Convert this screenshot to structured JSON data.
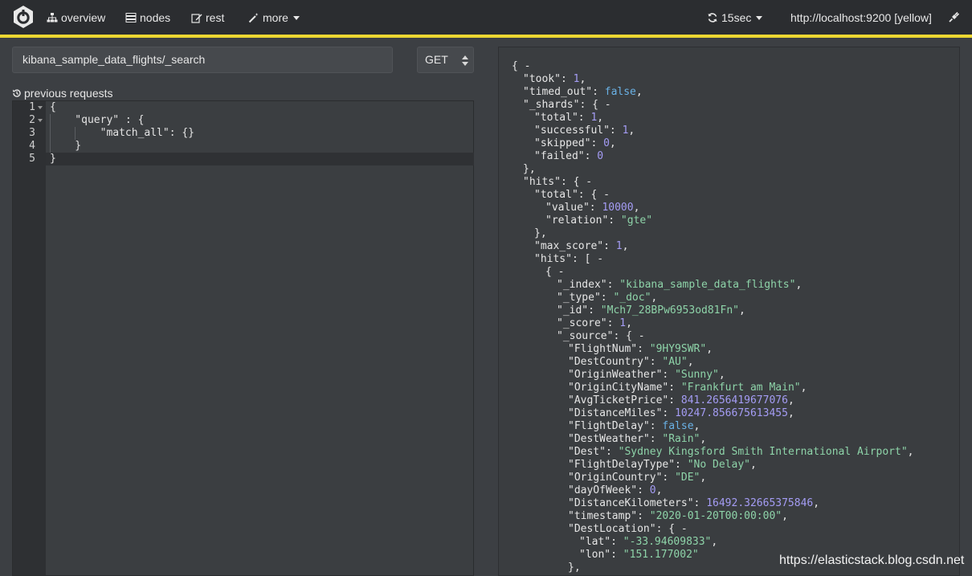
{
  "nav": {
    "overview": "overview",
    "nodes": "nodes",
    "rest": "rest",
    "more": "more",
    "refresh": "15sec",
    "cluster": "http://localhost:9200 [yellow]"
  },
  "colors": {
    "accent": "#ecd732",
    "string": "#8ed4a9",
    "number": "#a49cf4",
    "boolean": "#6ab2e6"
  },
  "request": {
    "path": "kibana_sample_data_flights/_search",
    "method": "GET",
    "previous_label": "previous requests"
  },
  "editor": {
    "line_numbers": [
      "1",
      "2",
      "3",
      "4",
      "5"
    ],
    "lines": [
      "{",
      "    \"query\" : {",
      "        \"match_all\": {}",
      "    }",
      "}"
    ]
  },
  "response": {
    "took": 1,
    "timed_out": false,
    "shards": {
      "total": 1,
      "successful": 1,
      "skipped": 0,
      "failed": 0
    },
    "hits_total": {
      "value": 10000,
      "relation": "gte"
    },
    "max_score": 1,
    "first_hit": {
      "_index": "kibana_sample_data_flights",
      "_type": "_doc",
      "_id": "Mch7_28BPw6953od81Fn",
      "_score": 1,
      "_source": {
        "FlightNum": "9HY9SWR",
        "DestCountry": "AU",
        "OriginWeather": "Sunny",
        "OriginCityName": "Frankfurt am Main",
        "AvgTicketPrice": 841.2656419677076,
        "DistanceMiles": 10247.856675613455,
        "FlightDelay": false,
        "DestWeather": "Rain",
        "Dest": "Sydney Kingsford Smith International Airport",
        "FlightDelayType": "No Delay",
        "OriginCountry": "DE",
        "dayOfWeek": 0,
        "DistanceKilometers": 16492.32665375846,
        "timestamp": "2020-01-20T00:00:00",
        "DestLocation": {
          "lat": "-33.94609833",
          "lon": "151.177002"
        }
      }
    }
  },
  "watermark": "https://elasticstack.blog.csdn.net"
}
